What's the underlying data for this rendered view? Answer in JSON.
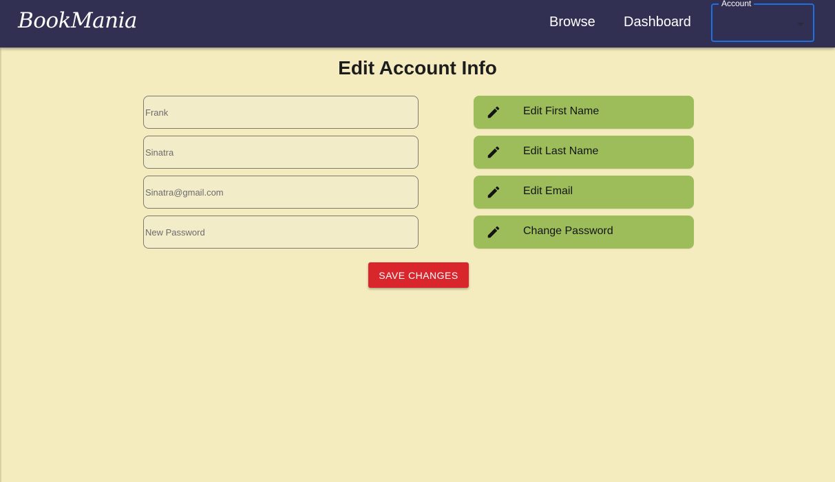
{
  "header": {
    "logo": "BookMania",
    "nav": {
      "browse": "Browse",
      "dashboard": "Dashboard"
    },
    "account": {
      "label": "Account",
      "value": ""
    }
  },
  "main": {
    "title": "Edit Account Info",
    "fields": {
      "first_name": {
        "value": "",
        "placeholder": "Frank"
      },
      "last_name": {
        "value": "",
        "placeholder": "Sinatra"
      },
      "email": {
        "value": "",
        "placeholder": "Sinatra@gmail.com"
      },
      "password": {
        "value": "",
        "placeholder": "New Password"
      }
    },
    "buttons": {
      "edit_first_name": "Edit First Name",
      "edit_last_name": "Edit Last Name",
      "edit_email": "Edit Email",
      "change_password": "Change Password",
      "save": "SAVE CHANGES"
    }
  },
  "icons": {
    "pencil": "pencil-icon",
    "caret": "chevron-down-icon"
  },
  "colors": {
    "header_bg": "#323052",
    "page_bg": "#f4ecbe",
    "edit_button": "#9cbd59",
    "save_button": "#d9262c",
    "focus_outline": "#1f6fe0"
  }
}
